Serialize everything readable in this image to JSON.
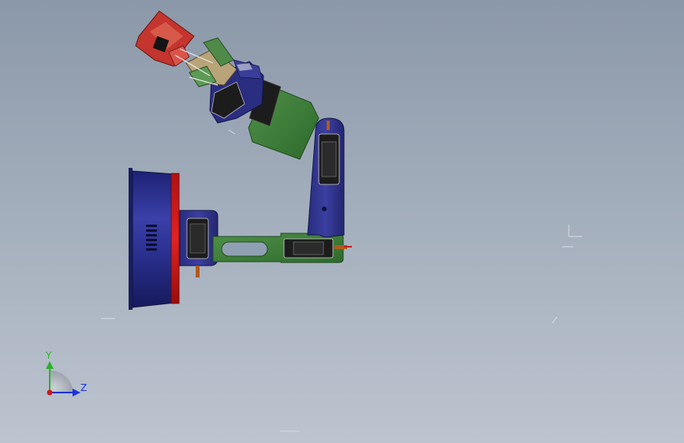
{
  "triad": {
    "y_label": "Y",
    "z_label": "Z",
    "y_color": "#2bb32b",
    "z_color": "#1a34d6",
    "x_color": "#d01818"
  },
  "colors": {
    "background_top": "#8b98a9",
    "background_bottom": "#bcc4cf",
    "base_blue": "#2a2f8a",
    "base_red": "#d01a1a",
    "bracket_blue": "#2c2f86",
    "bracket_green": "#3d7a3a",
    "servo_black": "#1c1c1c",
    "gripper_red": "#c83a32"
  }
}
